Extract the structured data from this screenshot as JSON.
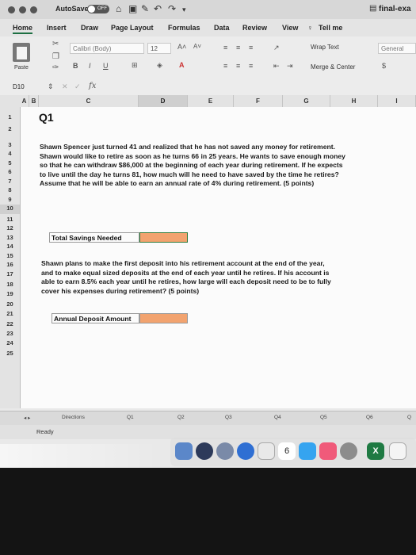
{
  "titlebar": {
    "autosave_label": "AutoSave",
    "autosave_state": "OFF",
    "filename": "final-exa"
  },
  "menu": [
    "Home",
    "Insert",
    "Draw",
    "Page Layout",
    "Formulas",
    "Data",
    "Review",
    "View"
  ],
  "tell_me": "Tell me",
  "ribbon": {
    "paste_label": "Paste",
    "font_name": "Calibri (Body)",
    "font_size": "12",
    "bold": "B",
    "italic": "I",
    "underline": "U",
    "wrap_text": "Wrap Text",
    "merge_center": "Merge & Center",
    "number_format": "General",
    "currency": "$"
  },
  "formula_bar": {
    "name_box": "D10",
    "fx": "fx",
    "value": ""
  },
  "columns": [
    "A",
    "B",
    "C",
    "D",
    "E",
    "F",
    "G",
    "H",
    "I"
  ],
  "rows": [
    "1",
    "2",
    "3",
    "4",
    "5",
    "6",
    "7",
    "8",
    "9",
    "10",
    "11",
    "12",
    "13",
    "14",
    "15",
    "16",
    "17",
    "18",
    "19",
    "20",
    "21",
    "22",
    "23",
    "24",
    "25"
  ],
  "sheet": {
    "title": "Q1",
    "q1_lines": [
      "Shawn Spencer just turned 41 and realized that he has not saved any money for retirement.",
      "Shawn would like to retire as soon as he turns 66 in 25 years.  He wants to save enough money",
      "so that he can withdraw $86,000 at the beginning of each year during retirement.  If he expects",
      "to live until the day he turns 81, how much will he need to have saved by the time he retires?",
      "Assume that he will be able to earn an annual rate of 4% during retirement. (5 points)"
    ],
    "label_total": "Total Savings Needed",
    "q2_lines": [
      "Shawn plans to make the first deposit into his retirement account at the end of the year,",
      "and to make equal sized deposits at the end of each year until he retires.  If his account is",
      "able to earn 8.5% each year until he retires, how large will each deposit need to be to fully",
      "cover his expenses during retirement? (5 points)"
    ],
    "label_annual": "Annual Deposit Amount",
    "answer_color": "#f2a36f"
  },
  "tabs": [
    "Directions",
    "Q1",
    "Q2",
    "Q3",
    "Q4",
    "Q5",
    "Q6",
    "Q"
  ],
  "status": "Ready",
  "dock_calendar_day": "6"
}
